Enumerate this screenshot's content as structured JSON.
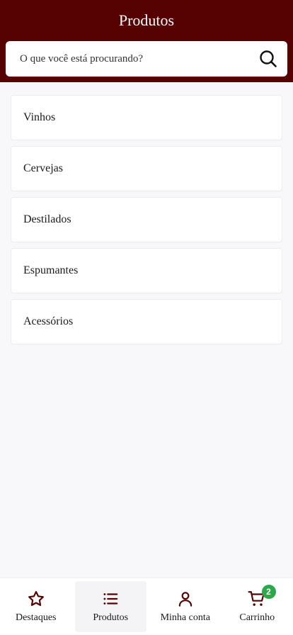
{
  "header": {
    "title": "Produtos",
    "search": {
      "placeholder": "O que você está procurando?",
      "value": "",
      "icon": "search-icon"
    }
  },
  "categories": [
    {
      "label": "Vinhos"
    },
    {
      "label": "Cervejas"
    },
    {
      "label": "Destilados"
    },
    {
      "label": "Espumantes"
    },
    {
      "label": "Acessórios"
    }
  ],
  "tabbar": {
    "items": [
      {
        "label": "Destaques",
        "icon": "star-icon"
      },
      {
        "label": "Produtos",
        "icon": "list-icon",
        "active": true
      },
      {
        "label": "Minha conta",
        "icon": "user-icon"
      },
      {
        "label": "Carrinho",
        "icon": "cart-icon",
        "badge": "2"
      }
    ]
  },
  "colors": {
    "brand": "#560202",
    "badge": "#2ca84a"
  }
}
